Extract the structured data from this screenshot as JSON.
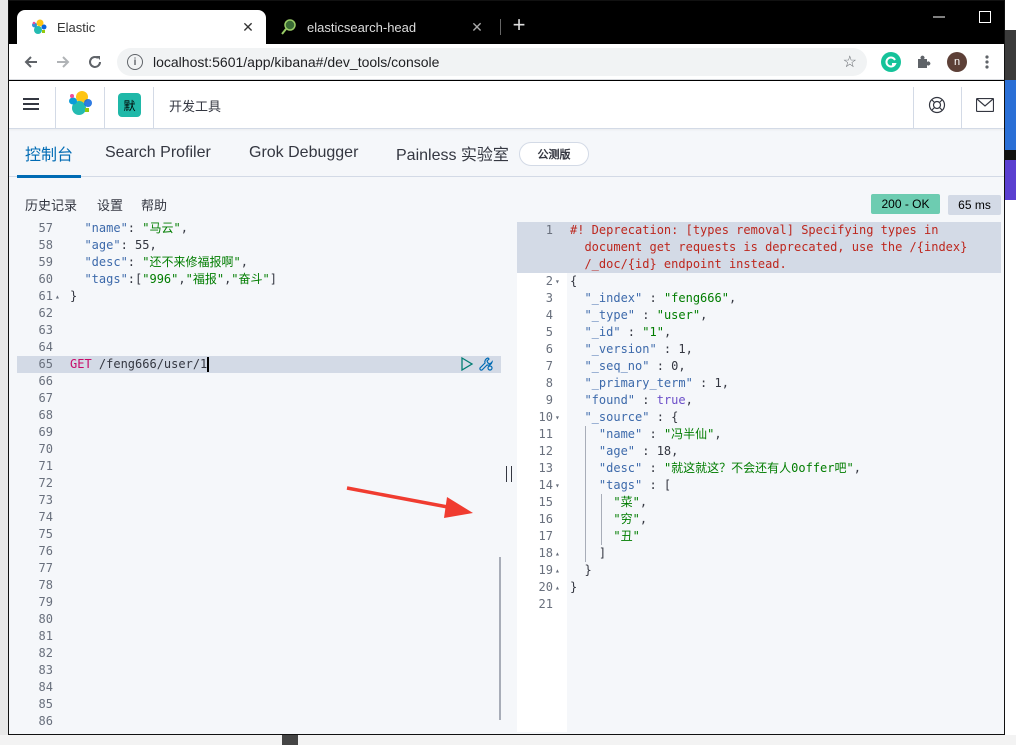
{
  "browser": {
    "tabs": [
      {
        "title": "Elastic",
        "active": true,
        "icon": "elastic-favicon"
      },
      {
        "title": "elasticsearch-head",
        "active": false,
        "icon": "elasticsearch-head-favicon"
      }
    ],
    "url": "localhost:5601/app/kibana#/dev_tools/console",
    "profile_initial": "n",
    "new_tab_label": "+"
  },
  "kibana": {
    "space_initial": "默",
    "app_title": "开发工具",
    "tabs": [
      {
        "label": "控制台",
        "selected": true
      },
      {
        "label": "Search Profiler",
        "selected": false
      },
      {
        "label": "Grok Debugger",
        "selected": false
      },
      {
        "label": "Painless 实验室",
        "selected": false
      }
    ],
    "beta_badge": "公测版",
    "menu": [
      "历史记录",
      "设置",
      "帮助"
    ],
    "status": {
      "code_text": "200 - OK",
      "time_text": "65 ms",
      "ok_color": "#6dccb1"
    }
  },
  "request_editor": {
    "lines": [
      {
        "num": "57",
        "fold": "",
        "parts": [
          [
            "k",
            "  \"name\""
          ],
          [
            "n",
            ": "
          ],
          [
            "s",
            "\"马云\""
          ],
          [
            "n",
            ","
          ]
        ]
      },
      {
        "num": "58",
        "fold": "",
        "parts": [
          [
            "k",
            "  \"age\""
          ],
          [
            "n",
            ": 55,"
          ]
        ]
      },
      {
        "num": "59",
        "fold": "",
        "parts": [
          [
            "k",
            "  \"desc\""
          ],
          [
            "n",
            ": "
          ],
          [
            "s",
            "\"还不来修福报啊\""
          ],
          [
            "n",
            ","
          ]
        ]
      },
      {
        "num": "60",
        "fold": "",
        "parts": [
          [
            "k",
            "  \"tags\""
          ],
          [
            "n",
            ":["
          ],
          [
            "s",
            "\"996\""
          ],
          [
            "n",
            ","
          ],
          [
            "s",
            "\"福报\""
          ],
          [
            "n",
            ","
          ],
          [
            "s",
            "\"奋斗\""
          ],
          [
            "n",
            "]"
          ]
        ]
      },
      {
        "num": "61",
        "fold": "▴",
        "parts": [
          [
            "n",
            "}"
          ]
        ]
      },
      {
        "num": "62",
        "fold": "",
        "parts": []
      },
      {
        "num": "63",
        "fold": "",
        "parts": []
      },
      {
        "num": "64",
        "fold": "",
        "parts": []
      },
      {
        "num": "65",
        "fold": "",
        "active": true,
        "parts": [
          [
            "m",
            "GET"
          ],
          [
            "n",
            " /feng666/user/1"
          ]
        ]
      },
      {
        "num": "66",
        "fold": "",
        "parts": []
      },
      {
        "num": "67",
        "fold": "",
        "parts": []
      },
      {
        "num": "68",
        "fold": "",
        "parts": []
      },
      {
        "num": "69",
        "fold": "",
        "parts": []
      },
      {
        "num": "70",
        "fold": "",
        "parts": []
      },
      {
        "num": "71",
        "fold": "",
        "parts": []
      },
      {
        "num": "72",
        "fold": "",
        "parts": []
      },
      {
        "num": "73",
        "fold": "",
        "parts": []
      },
      {
        "num": "74",
        "fold": "",
        "parts": []
      },
      {
        "num": "75",
        "fold": "",
        "parts": []
      },
      {
        "num": "76",
        "fold": "",
        "parts": []
      },
      {
        "num": "77",
        "fold": "",
        "parts": []
      },
      {
        "num": "78",
        "fold": "",
        "parts": []
      },
      {
        "num": "79",
        "fold": "",
        "parts": []
      },
      {
        "num": "80",
        "fold": "",
        "parts": []
      },
      {
        "num": "81",
        "fold": "",
        "parts": []
      },
      {
        "num": "82",
        "fold": "",
        "parts": []
      },
      {
        "num": "83",
        "fold": "",
        "parts": []
      },
      {
        "num": "84",
        "fold": "",
        "parts": []
      },
      {
        "num": "85",
        "fold": "",
        "parts": []
      },
      {
        "num": "86",
        "fold": "",
        "parts": []
      }
    ]
  },
  "response_editor": {
    "lines": [
      {
        "num": "1",
        "fold": "",
        "hl": true,
        "parts": [
          [
            "w",
            "#! Deprecation: [types removal] Specifying types in"
          ]
        ]
      },
      {
        "num": "",
        "fold": "",
        "hl": true,
        "parts": [
          [
            "w",
            "  document get requests is deprecated, use the /{index}"
          ]
        ]
      },
      {
        "num": "",
        "fold": "",
        "hl": true,
        "parts": [
          [
            "w",
            "  /_doc/{id} endpoint instead."
          ]
        ]
      },
      {
        "num": "2",
        "fold": "▾",
        "parts": [
          [
            "n",
            "{"
          ]
        ]
      },
      {
        "num": "3",
        "fold": "",
        "parts": [
          [
            "k",
            "  \"_index\""
          ],
          [
            "n",
            " : "
          ],
          [
            "s",
            "\"feng666\""
          ],
          [
            "n",
            ","
          ]
        ]
      },
      {
        "num": "4",
        "fold": "",
        "parts": [
          [
            "k",
            "  \"_type\""
          ],
          [
            "n",
            " : "
          ],
          [
            "s",
            "\"user\""
          ],
          [
            "n",
            ","
          ]
        ]
      },
      {
        "num": "5",
        "fold": "",
        "parts": [
          [
            "k",
            "  \"_id\""
          ],
          [
            "n",
            " : "
          ],
          [
            "s",
            "\"1\""
          ],
          [
            "n",
            ","
          ]
        ]
      },
      {
        "num": "6",
        "fold": "",
        "parts": [
          [
            "k",
            "  \"_version\""
          ],
          [
            "n",
            " : 1,"
          ]
        ]
      },
      {
        "num": "7",
        "fold": "",
        "parts": [
          [
            "k",
            "  \"_seq_no\""
          ],
          [
            "n",
            " : 0,"
          ]
        ]
      },
      {
        "num": "8",
        "fold": "",
        "parts": [
          [
            "k",
            "  \"_primary_term\""
          ],
          [
            "n",
            " : 1,"
          ]
        ]
      },
      {
        "num": "9",
        "fold": "",
        "parts": [
          [
            "k",
            "  \"found\""
          ],
          [
            "n",
            " : "
          ],
          [
            "b",
            "true"
          ],
          [
            "n",
            ","
          ]
        ]
      },
      {
        "num": "10",
        "fold": "▾",
        "parts": [
          [
            "k",
            "  \"_source\""
          ],
          [
            "n",
            " : {"
          ]
        ]
      },
      {
        "num": "11",
        "fold": "",
        "parts": [
          [
            "k",
            "    \"name\""
          ],
          [
            "n",
            " : "
          ],
          [
            "s",
            "\"冯半仙\""
          ],
          [
            "n",
            ","
          ]
        ]
      },
      {
        "num": "12",
        "fold": "",
        "parts": [
          [
            "k",
            "    \"age\""
          ],
          [
            "n",
            " : 18,"
          ]
        ]
      },
      {
        "num": "13",
        "fold": "",
        "parts": [
          [
            "k",
            "    \"desc\""
          ],
          [
            "n",
            " : "
          ],
          [
            "s",
            "\"就这就这？不会还有人0offer吧\""
          ],
          [
            "n",
            ","
          ]
        ]
      },
      {
        "num": "14",
        "fold": "▾",
        "parts": [
          [
            "k",
            "    \"tags\""
          ],
          [
            "n",
            " : ["
          ]
        ]
      },
      {
        "num": "15",
        "fold": "",
        "parts": [
          [
            "s",
            "      \"菜\""
          ],
          [
            "n",
            ","
          ]
        ]
      },
      {
        "num": "16",
        "fold": "",
        "parts": [
          [
            "s",
            "      \"穷\""
          ],
          [
            "n",
            ","
          ]
        ]
      },
      {
        "num": "17",
        "fold": "",
        "parts": [
          [
            "s",
            "      \"丑\""
          ]
        ]
      },
      {
        "num": "18",
        "fold": "▴",
        "parts": [
          [
            "n",
            "    ]"
          ]
        ]
      },
      {
        "num": "19",
        "fold": "▴",
        "parts": [
          [
            "n",
            "  }"
          ]
        ]
      },
      {
        "num": "20",
        "fold": "▴",
        "parts": [
          [
            "n",
            "}"
          ]
        ]
      },
      {
        "num": "21",
        "fold": "",
        "parts": []
      }
    ]
  }
}
